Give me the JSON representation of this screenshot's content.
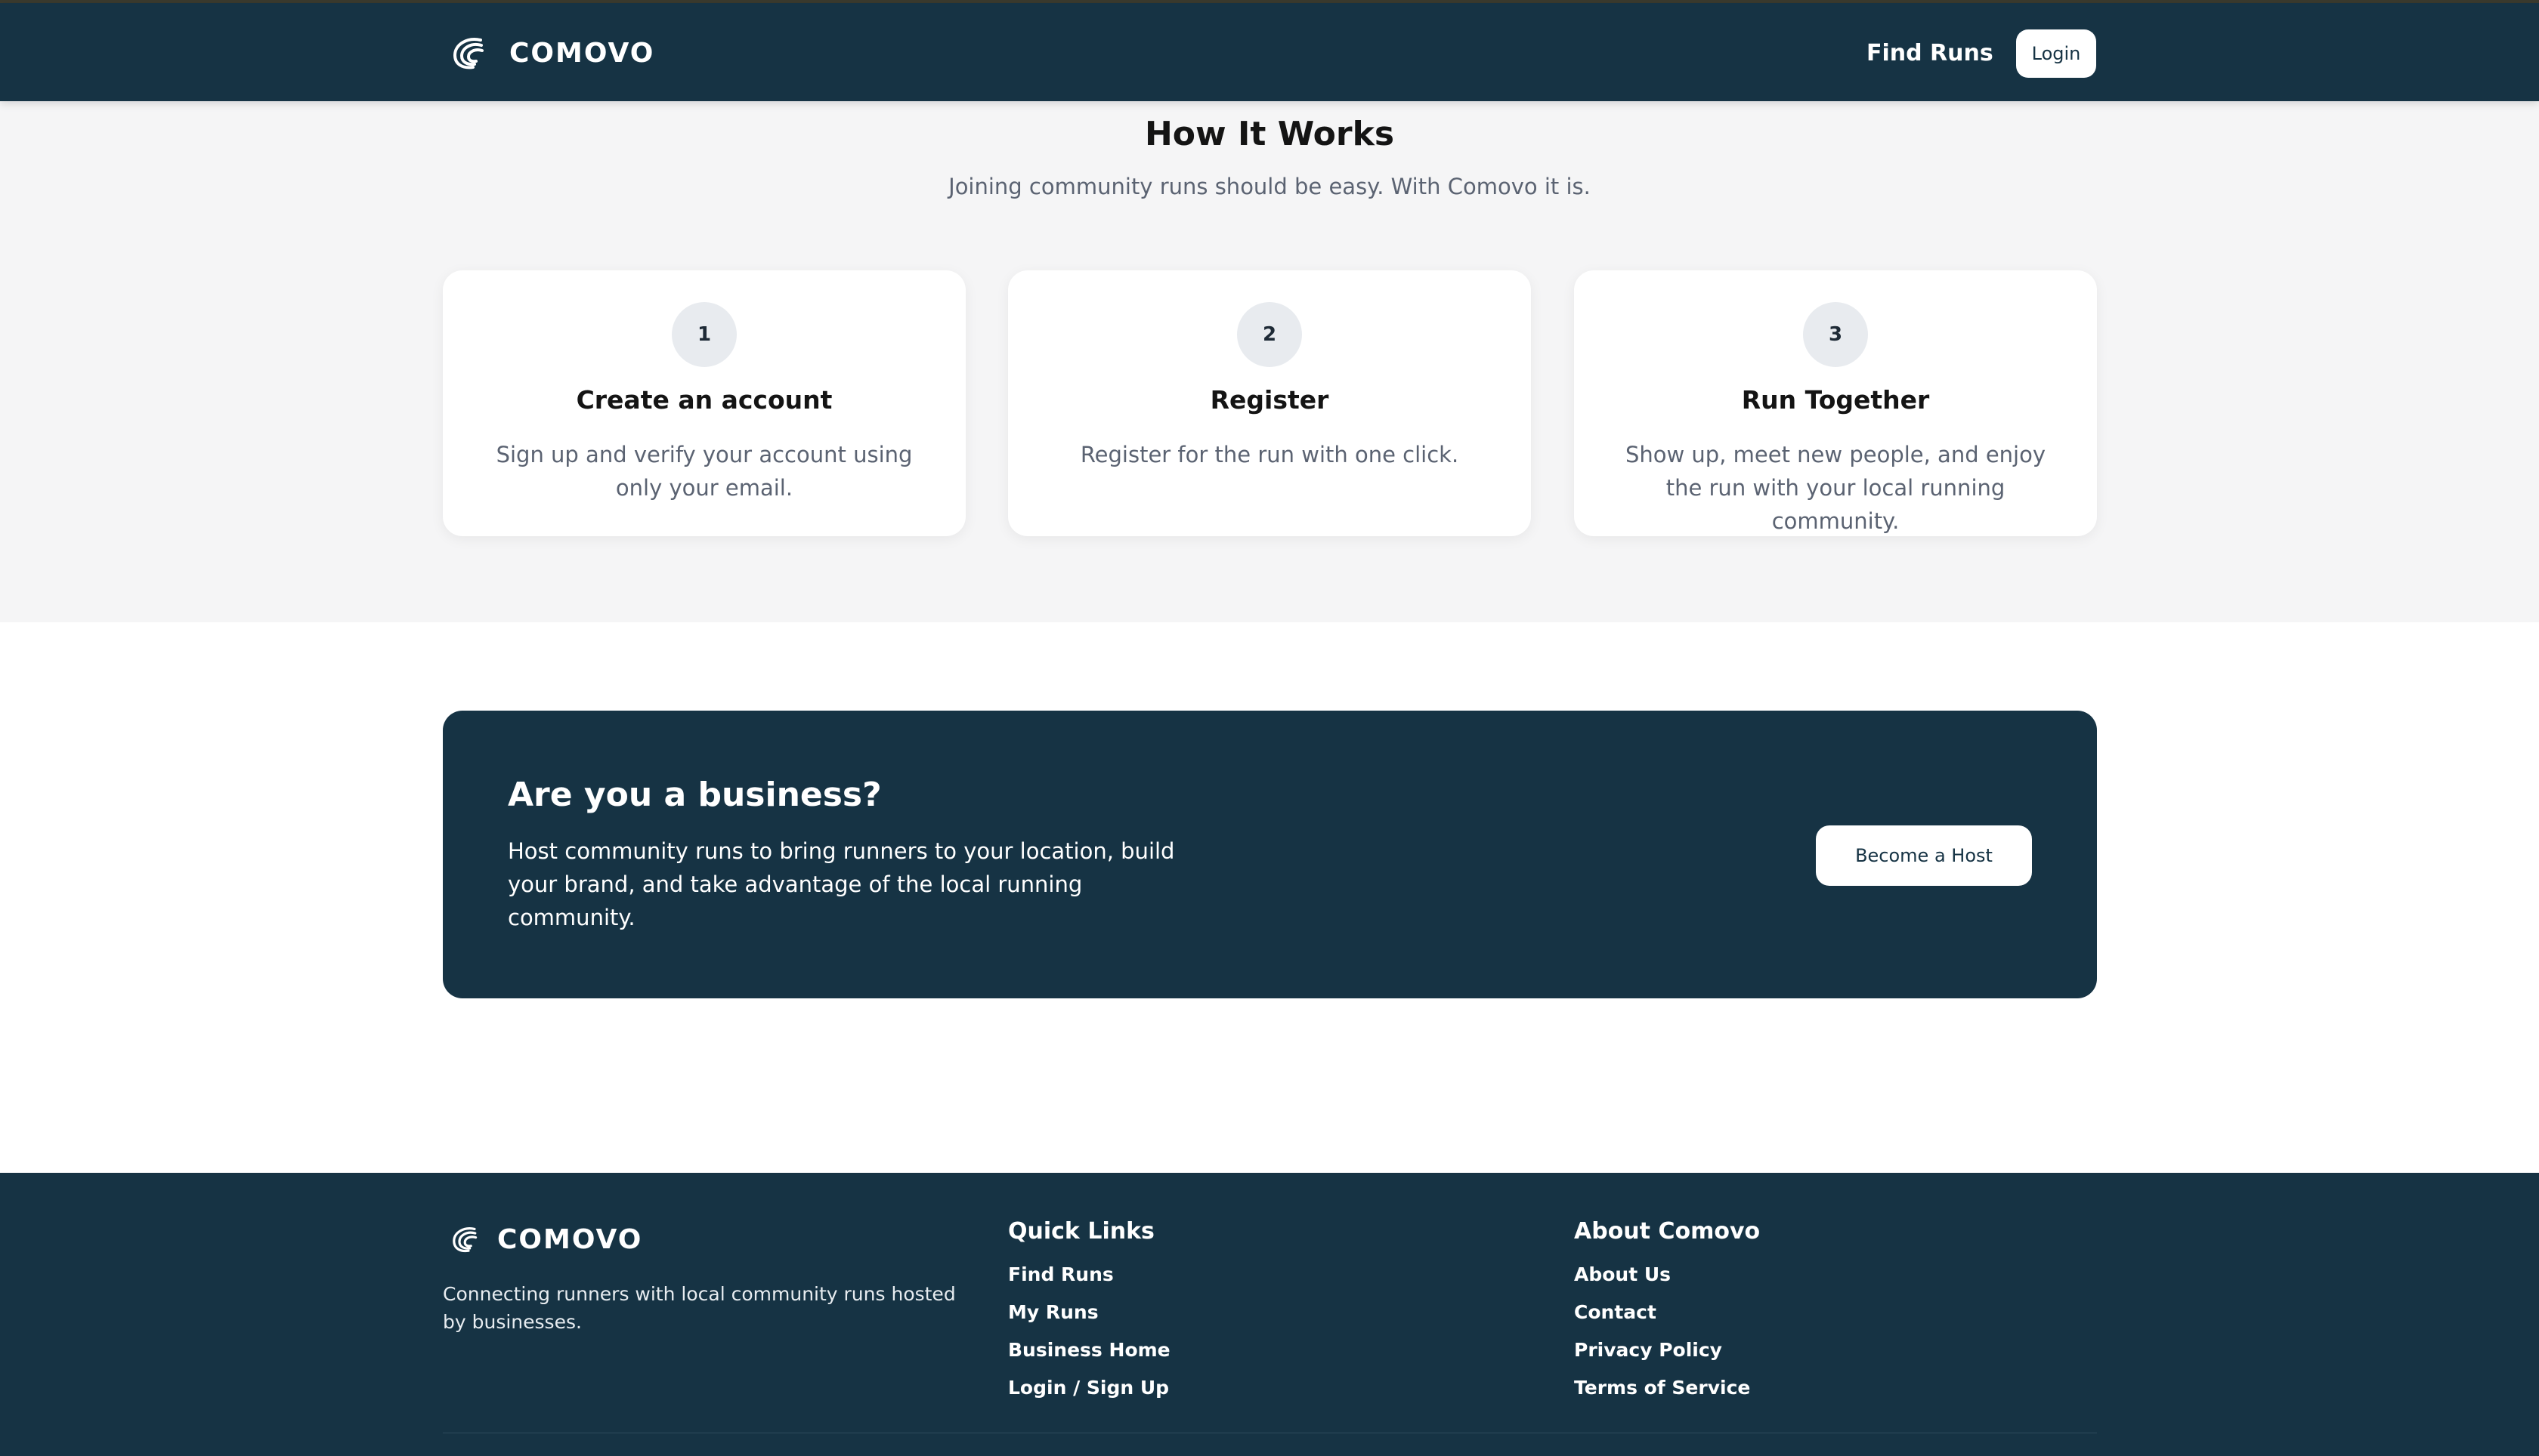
{
  "navbar": {
    "brand_name": "COMOVO",
    "logo_icon": "comovo-logo-icon",
    "links": [
      {
        "label": "Find Runs"
      }
    ],
    "login_label": "Login"
  },
  "how_it_works": {
    "title": "How It Works",
    "subtitle": "Joining community runs should be easy. With Comovo it is.",
    "steps": [
      {
        "number": "1",
        "title": "Create an account",
        "text": "Sign up and verify your account using only your email."
      },
      {
        "number": "2",
        "title": "Register",
        "text": "Register for the run with one click."
      },
      {
        "number": "3",
        "title": "Run Together",
        "text": "Show up, meet new people, and enjoy the run with your local running community."
      }
    ]
  },
  "business_cta": {
    "title": "Are you a business?",
    "text": "Host community runs to bring runners to your location, build your brand, and take advantage of the local running community.",
    "button_label": "Become a Host"
  },
  "footer": {
    "brand_name": "COMOVO",
    "tagline": "Connecting runners with local community runs hosted by businesses.",
    "quick_links": {
      "title": "Quick Links",
      "items": [
        {
          "label": "Find Runs"
        },
        {
          "label": "My Runs"
        },
        {
          "label": "Business Home"
        },
        {
          "label": "Login / Sign Up"
        }
      ]
    },
    "about": {
      "title": "About Comovo",
      "items": [
        {
          "label": "About Us"
        },
        {
          "label": "Contact"
        },
        {
          "label": "Privacy Policy"
        },
        {
          "label": "Terms of Service"
        }
      ]
    }
  },
  "colors": {
    "navy": "#163344",
    "section_bg": "#f5f5f6",
    "muted_text": "#5b6372"
  }
}
